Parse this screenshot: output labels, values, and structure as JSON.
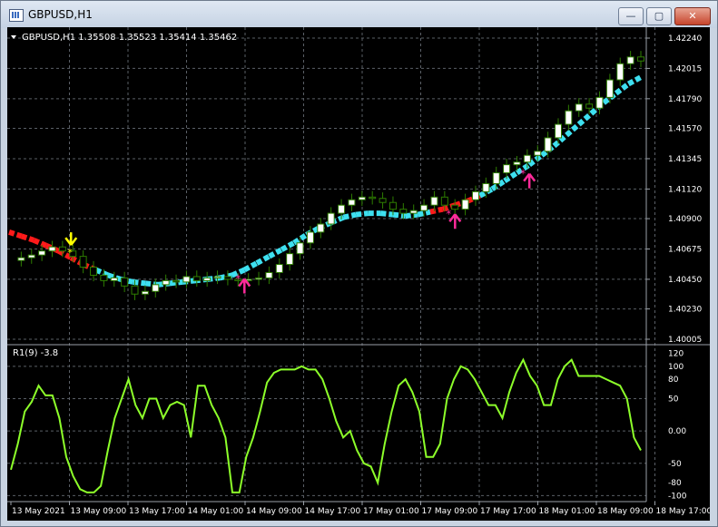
{
  "window": {
    "title": "GBPUSD,H1",
    "icon": "chart-window-icon",
    "buttons": {
      "minimize": "—",
      "maximize": "▢",
      "close": "✕"
    }
  },
  "main_panel": {
    "info_label": "GBPUSD,H1  1.35508 1.35523 1.35414 1.35462",
    "price_ticks": [
      "1.42240",
      "1.42015",
      "1.41790",
      "1.41570",
      "1.41345",
      "1.41120",
      "1.40900",
      "1.40675",
      "1.40450",
      "1.40230",
      "1.40005"
    ]
  },
  "sub_panel": {
    "label": "R1(9) -3.8",
    "ticks": [
      "120",
      "100",
      "80",
      "50",
      "0.00",
      "-50",
      "-80",
      "-100"
    ]
  },
  "time_ticks": [
    "13 May 2021",
    "13 May 09:00",
    "13 May 17:00",
    "14 May 01:00",
    "14 May 09:00",
    "14 May 17:00",
    "17 May 01:00",
    "17 May 09:00",
    "17 May 17:00",
    "18 May 01:00",
    "18 May 09:00",
    "18 May 17:00"
  ],
  "colors": {
    "background": "#000000",
    "grid": "#5a5f66",
    "candle_up": "#ffffff",
    "candle_down": "#000000",
    "candle_wick": "#2e7d00",
    "trend_up": "#3ee0f0",
    "trend_down": "#ff1a1a",
    "oscillator": "#8dff2a",
    "sell_arrow": "#ffff00",
    "buy_arrow": "#ff2a9a",
    "text": "#ffffff"
  },
  "chart_data": [
    {
      "type": "candlestick",
      "title": "GBPUSD,H1",
      "ohlc_label": "1.35508 1.35523 1.35414 1.35462",
      "ylim": [
        1.40005,
        1.4224
      ],
      "x_labels": [
        "13 May 2021",
        "13 May 09:00",
        "13 May 17:00",
        "14 May 01:00",
        "14 May 09:00",
        "14 May 17:00",
        "17 May 01:00",
        "17 May 09:00",
        "17 May 17:00",
        "18 May 01:00",
        "18 May 09:00",
        "18 May 17:00"
      ],
      "close_path": [
        1.4059,
        1.4061,
        1.4063,
        1.4066,
        1.4069,
        1.4066,
        1.4062,
        1.4054,
        1.4048,
        1.4044,
        1.4046,
        1.404,
        1.4034,
        1.4036,
        1.4041,
        1.4044,
        1.4043,
        1.4047,
        1.4044,
        1.4046,
        1.4047,
        1.4045,
        1.4044,
        1.4045,
        1.4046,
        1.405,
        1.4056,
        1.4064,
        1.4072,
        1.408,
        1.4086,
        1.4094,
        1.41,
        1.4104,
        1.4106,
        1.4105,
        1.4102,
        1.4097,
        1.4094,
        1.4096,
        1.41,
        1.4106,
        1.41,
        1.4097,
        1.4104,
        1.411,
        1.4116,
        1.4124,
        1.413,
        1.4132,
        1.4137,
        1.414,
        1.415,
        1.416,
        1.417,
        1.4175,
        1.4172,
        1.418,
        1.4193,
        1.4205,
        1.421,
        1.4207
      ],
      "trend_line": {
        "down_segments": [
          [
            0,
            6
          ],
          [
            34,
            37
          ]
        ],
        "values": [
          1.408,
          1.4077,
          1.4074,
          1.407,
          1.4066,
          1.4061,
          1.4056,
          1.4052,
          1.4048,
          1.4045,
          1.4043,
          1.4042,
          1.4041,
          1.4042,
          1.4043,
          1.4044,
          1.4045,
          1.4046,
          1.4048,
          1.4052,
          1.4057,
          1.4062,
          1.4067,
          1.4072,
          1.4078,
          1.4083,
          1.4087,
          1.4091,
          1.4093,
          1.4094,
          1.4094,
          1.4093,
          1.4092,
          1.4093,
          1.4095,
          1.4097,
          1.41,
          1.4103,
          1.4107,
          1.4112,
          1.4118,
          1.4124,
          1.413,
          1.4137,
          1.4144,
          1.4152,
          1.416,
          1.4168,
          1.4176,
          1.4183,
          1.419,
          1.4195
        ]
      },
      "signals": [
        {
          "type": "sell",
          "index": 5
        },
        {
          "type": "buy",
          "index": 19
        },
        {
          "type": "buy",
          "index": 36
        },
        {
          "type": "buy",
          "index": 42
        }
      ]
    },
    {
      "type": "line",
      "title": "R1(9) -3.8",
      "ylim": [
        -105,
        125
      ],
      "y_ticks": [
        120,
        100,
        80,
        50,
        0,
        -50,
        -80,
        -100
      ],
      "values": [
        -60,
        -20,
        30,
        45,
        70,
        55,
        55,
        20,
        -40,
        -70,
        -90,
        -95,
        -95,
        -85,
        -30,
        20,
        50,
        80,
        40,
        20,
        50,
        50,
        20,
        40,
        45,
        40,
        -10,
        70,
        70,
        40,
        20,
        -10,
        -95,
        -95,
        -40,
        -10,
        30,
        75,
        90,
        95,
        95,
        95,
        100,
        95,
        95,
        80,
        50,
        15,
        -10,
        0,
        -30,
        -50,
        -55,
        -80,
        -20,
        30,
        70,
        80,
        60,
        30,
        -40,
        -40,
        -20,
        50,
        80,
        100,
        95,
        80,
        60,
        40,
        40,
        20,
        60,
        90,
        110,
        85,
        70,
        40,
        40,
        80,
        100,
        110,
        85,
        85,
        85,
        85,
        80,
        75,
        70,
        50,
        -10,
        -30
      ]
    }
  ]
}
